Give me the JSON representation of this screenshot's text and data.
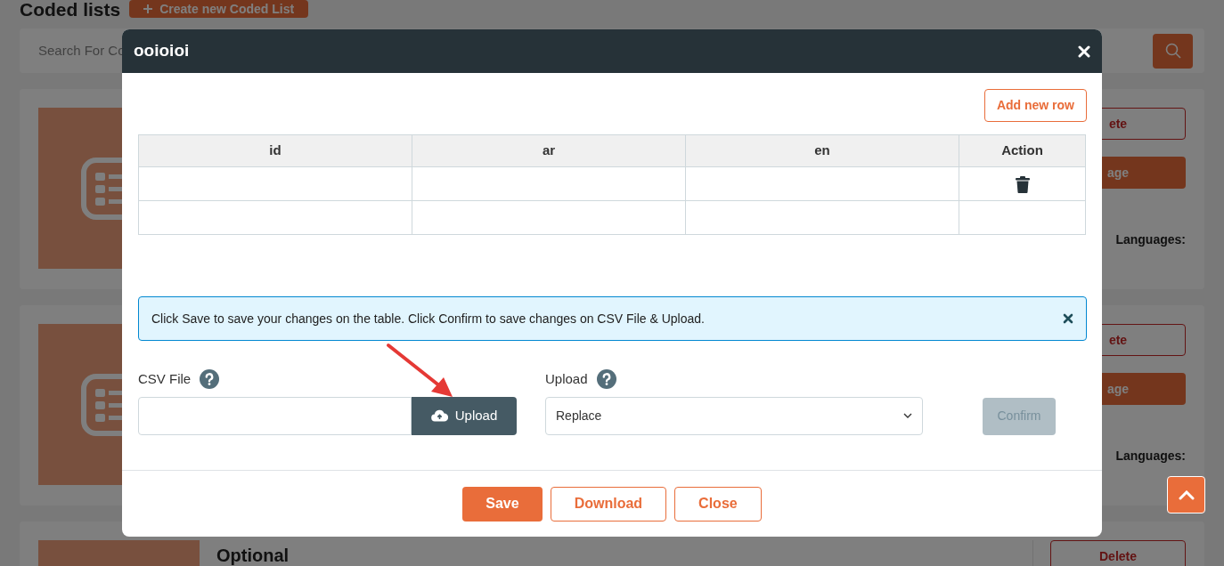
{
  "page": {
    "title": "Coded lists",
    "create_button": "Create new Coded List",
    "search": {
      "placeholder": "Search For Co"
    }
  },
  "cards": [
    {
      "buttons": [
        {
          "kind": "delete",
          "label": "ete"
        },
        {
          "kind": "manage",
          "label": "age"
        }
      ],
      "label": "Languages:"
    },
    {
      "buttons": [
        {
          "kind": "delete",
          "label": "ete"
        },
        {
          "kind": "manage",
          "label": "age"
        }
      ],
      "label": "Languages:"
    },
    {
      "title": "Optional",
      "buttons": [
        {
          "kind": "delete",
          "label": "Delete"
        }
      ]
    }
  ],
  "modal": {
    "title": "ooioioi",
    "add_row_button": "Add new row",
    "table": {
      "columns": [
        "id",
        "ar",
        "en",
        "Action"
      ],
      "rows": [
        {
          "delete_icon": true
        },
        {
          "delete_icon": false
        }
      ]
    },
    "alert": "Click Save to save your changes on the table. Click Confirm to save changes on CSV File & Upload.",
    "csv_file": {
      "label": "CSV File",
      "button": "Upload"
    },
    "upload": {
      "label": "Upload",
      "value": "Replace"
    },
    "confirm": {
      "label": "Confirm",
      "disabled": true
    },
    "footer": [
      {
        "kind": "primary",
        "label": "Save"
      },
      {
        "kind": "outline",
        "label": "Download"
      },
      {
        "kind": "outline",
        "label": "Close"
      }
    ]
  }
}
